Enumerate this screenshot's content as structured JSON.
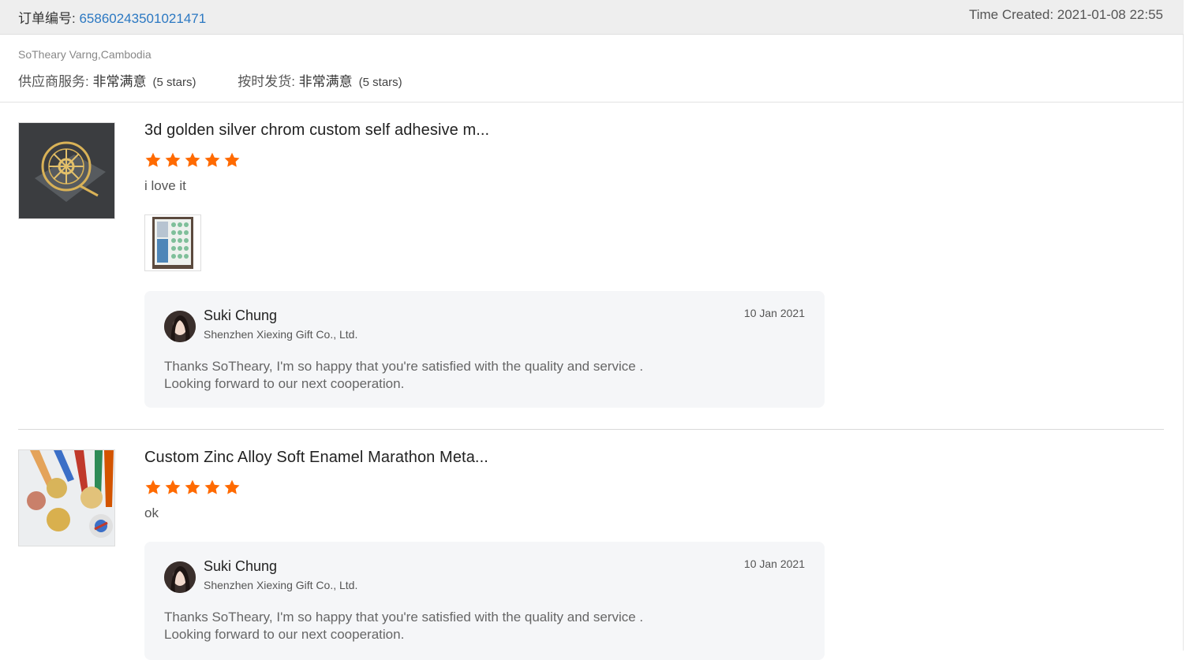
{
  "order": {
    "label": "订单编号: ",
    "number": "65860243501021471",
    "time_created": "Time Created: 2021-01-08 22:55"
  },
  "buyer": "SoTheary Varng,Cambodia",
  "ratings": [
    {
      "label": "供应商服务: ",
      "value": "非常满意",
      "stars": "(5 stars)"
    },
    {
      "label": "按时发货: ",
      "value": "非常满意",
      "stars": "(5 stars)"
    }
  ],
  "reviews": [
    {
      "product_title": "3d golden silver chrom custom self adhesive m...",
      "rating": 5,
      "comment": "i love it",
      "reply": {
        "name": "Suki Chung",
        "company": "Shenzhen Xiexing Gift Co., Ltd.",
        "date": "10 Jan 2021",
        "line1": "Thanks SoTheary, I'm so happy that you're satisfied with the quality and service .",
        "line2": "Looking forward to our next cooperation."
      }
    },
    {
      "product_title": "Custom Zinc Alloy Soft Enamel Marathon Meta...",
      "rating": 5,
      "comment": "ok",
      "reply": {
        "name": "Suki Chung",
        "company": "Shenzhen Xiexing Gift Co., Ltd.",
        "date": "10 Jan 2021",
        "line1": "Thanks SoTheary, I'm so happy that you're satisfied with the quality and service .",
        "line2": "Looking forward to our next cooperation."
      }
    }
  ],
  "colors": {
    "star": "#ff6a00",
    "link": "#2b78c2",
    "header_bg": "#eeeeee",
    "reply_bg": "#f5f6f8"
  },
  "icons": {
    "star": "star-icon"
  }
}
